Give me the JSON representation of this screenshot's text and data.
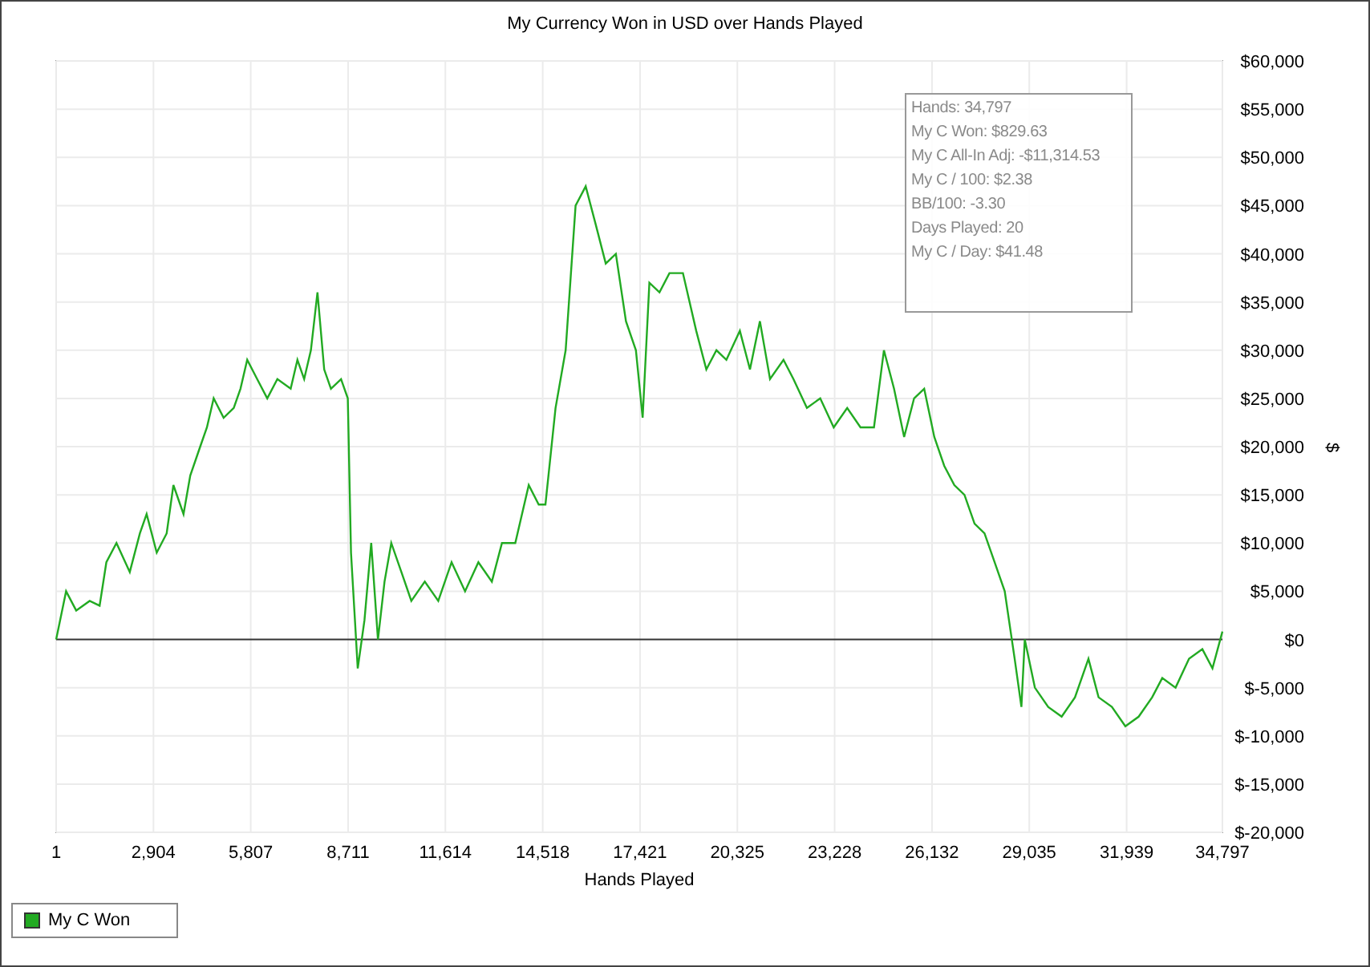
{
  "chart_data": {
    "type": "line",
    "grid": true,
    "title": "My Currency Won in USD over Hands Played",
    "xlabel": "Hands Played",
    "ylabel": "$",
    "x": [
      1,
      300,
      600,
      1000,
      1300,
      1500,
      1800,
      2200,
      2500,
      2700,
      3000,
      3300,
      3500,
      3800,
      4000,
      4300,
      4500,
      4700,
      5000,
      5300,
      5500,
      5700,
      6000,
      6300,
      6600,
      7000,
      7200,
      7400,
      7600,
      7800,
      8000,
      8200,
      8500,
      8700,
      8800,
      9000,
      9200,
      9400,
      9600,
      9800,
      10000,
      10300,
      10600,
      11000,
      11400,
      11800,
      12200,
      12600,
      13000,
      13300,
      13700,
      14100,
      14400,
      14600,
      14900,
      15200,
      15500,
      15800,
      16100,
      16400,
      16700,
      17000,
      17300,
      17500,
      17700,
      18000,
      18300,
      18700,
      19100,
      19400,
      19700,
      20000,
      20400,
      20700,
      21000,
      21300,
      21700,
      22000,
      22400,
      22800,
      23200,
      23600,
      24000,
      24400,
      24700,
      25000,
      25300,
      25600,
      25900,
      26200,
      26500,
      26800,
      27100,
      27400,
      27700,
      28000,
      28300,
      28600,
      28800,
      28900,
      29200,
      29600,
      30000,
      30400,
      30800,
      31100,
      31500,
      31900,
      32300,
      32700,
      33000,
      33400,
      33800,
      34200,
      34500,
      34797
    ],
    "series": [
      {
        "name": "My C Won",
        "color": "#22aa22",
        "values": [
          0,
          5000,
          3000,
          4000,
          3500,
          8000,
          10000,
          7000,
          11000,
          13000,
          9000,
          11000,
          16000,
          13000,
          17000,
          20000,
          22000,
          25000,
          23000,
          24000,
          26000,
          29000,
          27000,
          25000,
          27000,
          26000,
          29000,
          27000,
          30000,
          36000,
          28000,
          26000,
          27000,
          25000,
          9000,
          -3000,
          2000,
          10000,
          0,
          6000,
          10000,
          7000,
          4000,
          6000,
          4000,
          8000,
          5000,
          8000,
          6000,
          10000,
          10000,
          16000,
          14000,
          14000,
          24000,
          30000,
          45000,
          47000,
          43000,
          39000,
          40000,
          33000,
          30000,
          23000,
          37000,
          36000,
          38000,
          38000,
          32000,
          28000,
          30000,
          29000,
          32000,
          28000,
          33000,
          27000,
          29000,
          27000,
          24000,
          25000,
          22000,
          24000,
          22000,
          22000,
          30000,
          26000,
          21000,
          25000,
          26000,
          21000,
          18000,
          16000,
          15000,
          12000,
          11000,
          8000,
          5000,
          -2000,
          -7000,
          0,
          -5000,
          -7000,
          -8000,
          -6000,
          -2000,
          -6000,
          -7000,
          -9000,
          -8000,
          -6000,
          -4000,
          -5000,
          -2000,
          -1000,
          -3000,
          830
        ]
      }
    ],
    "xlim": [
      1,
      34797
    ],
    "ylim": [
      -20000,
      60000
    ],
    "xticks": [
      {
        "value": 1,
        "label": "1"
      },
      {
        "value": 2904,
        "label": "2,904"
      },
      {
        "value": 5807,
        "label": "5,807"
      },
      {
        "value": 8711,
        "label": "8,711"
      },
      {
        "value": 11614,
        "label": "11,614"
      },
      {
        "value": 14518,
        "label": "14,518"
      },
      {
        "value": 17421,
        "label": "17,421"
      },
      {
        "value": 20325,
        "label": "20,325"
      },
      {
        "value": 23228,
        "label": "23,228"
      },
      {
        "value": 26132,
        "label": "26,132"
      },
      {
        "value": 29035,
        "label": "29,035"
      },
      {
        "value": 31939,
        "label": "31,939"
      },
      {
        "value": 34797,
        "label": "34,797"
      }
    ],
    "yticks": [
      {
        "value": 60000,
        "label": "$60,000"
      },
      {
        "value": 55000,
        "label": "$55,000"
      },
      {
        "value": 50000,
        "label": "$50,000"
      },
      {
        "value": 45000,
        "label": "$45,000"
      },
      {
        "value": 40000,
        "label": "$40,000"
      },
      {
        "value": 35000,
        "label": "$35,000"
      },
      {
        "value": 30000,
        "label": "$30,000"
      },
      {
        "value": 25000,
        "label": "$25,000"
      },
      {
        "value": 20000,
        "label": "$20,000"
      },
      {
        "value": 15000,
        "label": "$15,000"
      },
      {
        "value": 10000,
        "label": "$10,000"
      },
      {
        "value": 5000,
        "label": "$5,000"
      },
      {
        "value": 0,
        "label": "$0"
      },
      {
        "value": -5000,
        "label": "$-5,000"
      },
      {
        "value": -10000,
        "label": "$-10,000"
      },
      {
        "value": -15000,
        "label": "$-15,000"
      },
      {
        "value": -20000,
        "label": "$-20,000"
      }
    ]
  },
  "tooltip": {
    "lines": [
      "Hands: 34,797",
      "My C Won: $829.63",
      "My C All-In Adj: -$11,314.53",
      "My C / 100: $2.38",
      "BB/100: -3.30",
      "Days Played: 20",
      "My C / Day: $41.48"
    ]
  }
}
